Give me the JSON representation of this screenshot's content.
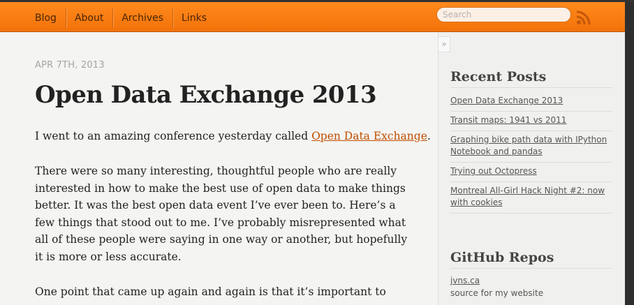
{
  "nav": {
    "items": [
      "Blog",
      "About",
      "Archives",
      "Links"
    ],
    "search_placeholder": "Search",
    "rss_icon": "rss-icon",
    "accent_color": "#f57c0f"
  },
  "post": {
    "date": "APR 7TH, 2013",
    "title": "Open Data Exchange 2013",
    "p1_before": "I went to an amazing conference yesterday called ",
    "p1_link": "Open Data Exchange",
    "p1_after": ".",
    "p2": "There were so many interesting, thoughtful people who are really interested in how to make the best use of open data to make things better. It was the best open data event I’ve ever been to. Here’s a few things that stood out to me. I’ve probably misrepresented what all of these people were saying in one way or another, but hopefully it is more or less accurate.",
    "p3": "One point that came up again and again is that it’s important to"
  },
  "sidebar": {
    "collapse_glyph": "»",
    "recent_heading": "Recent Posts",
    "recent_posts": [
      "Open Data Exchange 2013",
      "Transit maps: 1941 vs 2011",
      "Graphing bike path data with IPython Notebook and pandas",
      "Trying out Octopress",
      "Montreal All-Girl Hack Night #2: now with cookies"
    ],
    "github_heading": "GitHub Repos",
    "repo_name": "jvns.ca",
    "repo_desc": "source for my website"
  }
}
